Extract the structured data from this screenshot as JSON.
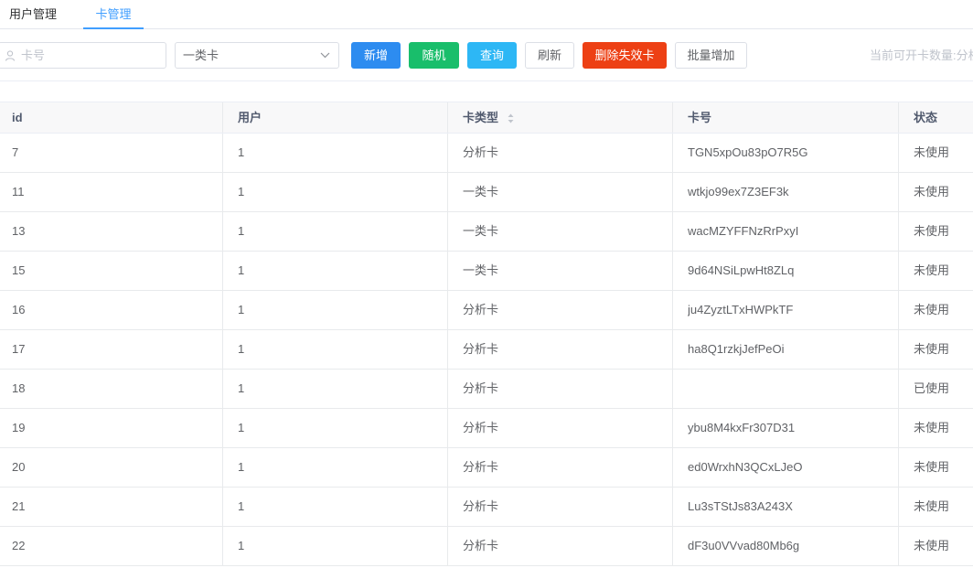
{
  "tabs": [
    {
      "label": "用户管理"
    },
    {
      "label": "卡管理"
    }
  ],
  "toolbar": {
    "search_placeholder": "卡号",
    "search_value": "",
    "select_value": "一类卡",
    "add_label": "新增",
    "random_label": "随机",
    "query_label": "查询",
    "refresh_label": "刷新",
    "delete_invalid_label": "删除失效卡",
    "batch_add_label": "批量增加",
    "info_text": "当前可开卡数量:分析"
  },
  "colors": {
    "primary": "#2d8cf0",
    "success": "#19be6b",
    "info": "#2db7f5",
    "danger": "#ed4014",
    "active_tab": "#409eff"
  },
  "table": {
    "columns": [
      "id",
      "用户",
      "卡类型",
      "卡号",
      "状态"
    ],
    "rows": [
      {
        "id": "7",
        "user": "1",
        "type": "分析卡",
        "card": "TGN5xpOu83pO7R5G",
        "status": "未使用"
      },
      {
        "id": "11",
        "user": "1",
        "type": "一类卡",
        "card": "wtkjo99ex7Z3EF3k",
        "status": "未使用"
      },
      {
        "id": "13",
        "user": "1",
        "type": "一类卡",
        "card": "wacMZYFFNzRrPxyI",
        "status": "未使用"
      },
      {
        "id": "15",
        "user": "1",
        "type": "一类卡",
        "card": "9d64NSiLpwHt8ZLq",
        "status": "未使用"
      },
      {
        "id": "16",
        "user": "1",
        "type": "分析卡",
        "card": "ju4ZyztLTxHWPkTF",
        "status": "未使用"
      },
      {
        "id": "17",
        "user": "1",
        "type": "分析卡",
        "card": "ha8Q1rzkjJefPeOi",
        "status": "未使用"
      },
      {
        "id": "18",
        "user": "1",
        "type": "分析卡",
        "card": "",
        "status": "已使用"
      },
      {
        "id": "19",
        "user": "1",
        "type": "分析卡",
        "card": "ybu8M4kxFr307D31",
        "status": "未使用"
      },
      {
        "id": "20",
        "user": "1",
        "type": "分析卡",
        "card": "ed0WrxhN3QCxLJeO",
        "status": "未使用"
      },
      {
        "id": "21",
        "user": "1",
        "type": "分析卡",
        "card": "Lu3sTStJs83A243X",
        "status": "未使用"
      },
      {
        "id": "22",
        "user": "1",
        "type": "分析卡",
        "card": "dF3u0VVvad80Mb6g",
        "status": "未使用"
      }
    ]
  }
}
